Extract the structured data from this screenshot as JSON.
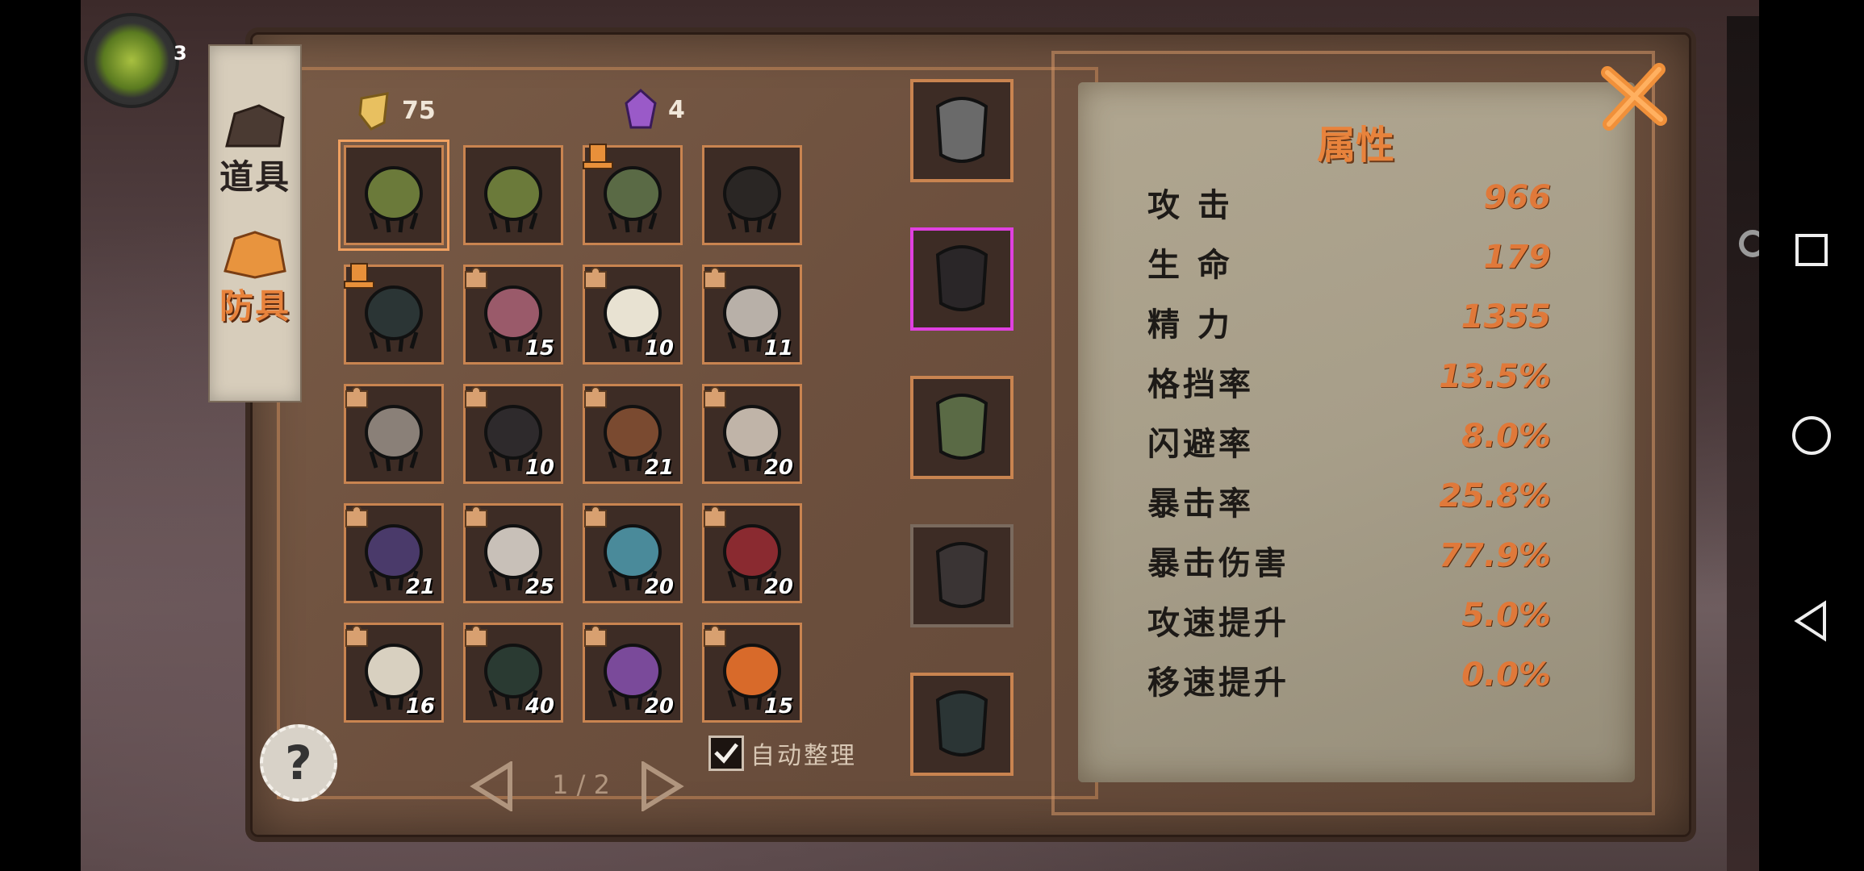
{
  "player": {
    "level": "3"
  },
  "tabs": [
    {
      "label": "道具",
      "active": false
    },
    {
      "label": "防具",
      "active": true
    }
  ],
  "currencies": [
    {
      "icon": "gold-shard-icon",
      "value": "75"
    },
    {
      "icon": "purple-gem-icon",
      "value": "4"
    }
  ],
  "inventory": [
    {
      "name": "green-spiked-gauntlet",
      "count": "",
      "selected": true,
      "piece": false,
      "hat": false,
      "color": "#6b7a3a"
    },
    {
      "name": "green-spiked-gauntlet",
      "count": "",
      "selected": false,
      "piece": false,
      "hat": false,
      "color": "#6b7a3a"
    },
    {
      "name": "green-spiked-helmet",
      "count": "",
      "selected": false,
      "piece": false,
      "hat": true,
      "color": "#5a6a45"
    },
    {
      "name": "black-hood-eye",
      "count": "",
      "selected": false,
      "piece": false,
      "hat": false,
      "color": "#2a2624"
    },
    {
      "name": "teal-claw-gloves",
      "count": "",
      "selected": false,
      "piece": false,
      "hat": true,
      "color": "#2b3535"
    },
    {
      "name": "pink-coat-fragment",
      "count": "15",
      "selected": false,
      "piece": true,
      "hat": false,
      "color": "#9a5a6a"
    },
    {
      "name": "white-gold-robe-fragment",
      "count": "10",
      "selected": false,
      "piece": true,
      "hat": false,
      "color": "#e8e2d2"
    },
    {
      "name": "bandaged-vest-fragment",
      "count": "11",
      "selected": false,
      "piece": true,
      "hat": false,
      "color": "#b8b0a8"
    },
    {
      "name": "spiked-bracer-fragment",
      "count": "",
      "selected": false,
      "piece": true,
      "hat": false,
      "color": "#8a8078"
    },
    {
      "name": "black-pink-armor-fragment",
      "count": "10",
      "selected": false,
      "piece": true,
      "hat": false,
      "color": "#2e2a2c"
    },
    {
      "name": "leather-shoulder-fragment",
      "count": "21",
      "selected": false,
      "piece": true,
      "hat": false,
      "color": "#7a4a30"
    },
    {
      "name": "fur-cape-fragment",
      "count": "20",
      "selected": false,
      "piece": true,
      "hat": false,
      "color": "#c0b4a8"
    },
    {
      "name": "purple-jacket-fragment",
      "count": "21",
      "selected": false,
      "piece": true,
      "hat": false,
      "color": "#4a3a6a"
    },
    {
      "name": "skull-helm-fragment",
      "count": "25",
      "selected": false,
      "piece": true,
      "hat": false,
      "color": "#c8c0b8"
    },
    {
      "name": "teal-horned-helm-fragment",
      "count": "20",
      "selected": false,
      "piece": true,
      "hat": false,
      "color": "#4a8a9a"
    },
    {
      "name": "red-hood-fragment",
      "count": "20",
      "selected": false,
      "piece": true,
      "hat": false,
      "color": "#8a2a30"
    },
    {
      "name": "silver-crown-fragment",
      "count": "16",
      "selected": false,
      "piece": true,
      "hat": false,
      "color": "#d8d0c0"
    },
    {
      "name": "dark-green-eye-helm-fragment",
      "count": "40",
      "selected": false,
      "piece": true,
      "hat": false,
      "color": "#2a3a32"
    },
    {
      "name": "purple-fanged-helm-fragment",
      "count": "20",
      "selected": false,
      "piece": true,
      "hat": false,
      "color": "#7a4a9a"
    },
    {
      "name": "orange-flame-helm-fragment",
      "count": "15",
      "selected": false,
      "piece": true,
      "hat": false,
      "color": "#d86a2a"
    }
  ],
  "equipped": [
    {
      "name": "bloody-axe-weapon",
      "color": "#6a6a6a",
      "border": "normal"
    },
    {
      "name": "dark-winged-armor",
      "color": "#2a2628",
      "border": "purple"
    },
    {
      "name": "green-spiked-helmet",
      "color": "#5a6a45",
      "border": "normal"
    },
    {
      "name": "dark-cape-armor",
      "color": "#3a3434",
      "border": "grey"
    },
    {
      "name": "teal-claw-gloves",
      "color": "#2b3535",
      "border": "normal"
    }
  ],
  "stats": {
    "title": "属性",
    "rows": [
      {
        "label": "攻  击",
        "value": "966"
      },
      {
        "label": "生  命",
        "value": "179"
      },
      {
        "label": "精  力",
        "value": "1355"
      },
      {
        "label": "格挡率",
        "value": "13.5%"
      },
      {
        "label": "闪避率",
        "value": "8.0%"
      },
      {
        "label": "暴击率",
        "value": "25.8%"
      },
      {
        "label": "暴击伤害",
        "value": "77.9%"
      },
      {
        "label": "攻速提升",
        "value": "5.0%"
      },
      {
        "label": "移速提升",
        "value": "0.0%"
      }
    ]
  },
  "pager": {
    "text": "1 / 2"
  },
  "auto_sort": {
    "label": "自动整理",
    "checked": true
  },
  "help": {
    "label": "?"
  },
  "colors": {
    "accent": "#e8833c",
    "slot_border": "#c98450",
    "purple_highlight": "#e040e0"
  }
}
